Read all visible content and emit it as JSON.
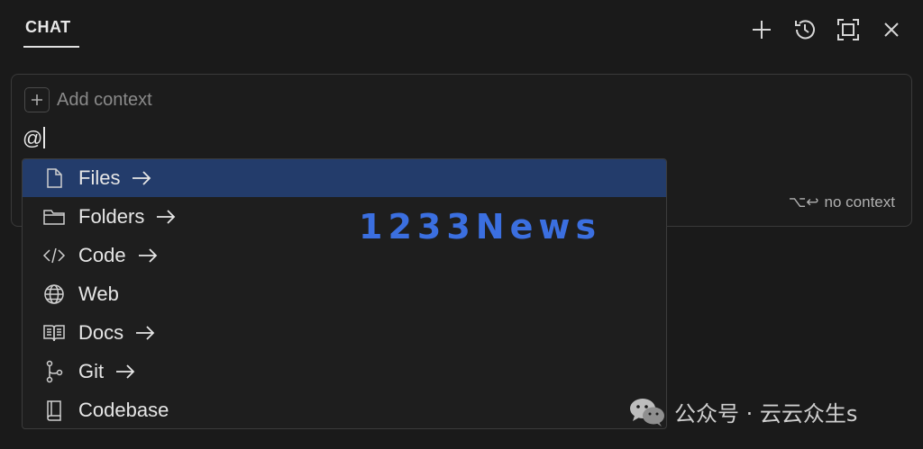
{
  "header": {
    "tab_label": "CHAT",
    "actions": [
      {
        "name": "new-chat",
        "icon": "plus-icon"
      },
      {
        "name": "history",
        "icon": "history-icon"
      },
      {
        "name": "maximize",
        "icon": "maximize-icon"
      },
      {
        "name": "close",
        "icon": "close-icon"
      }
    ]
  },
  "chat_input": {
    "add_context_label": "Add context",
    "typed_value": "@",
    "hint_keys": "⌥↩",
    "hint_label": "no context"
  },
  "mention_menu": {
    "selected_index": 0,
    "items": [
      {
        "label": "Files",
        "icon": "file-icon",
        "has_submenu": true
      },
      {
        "label": "Folders",
        "icon": "folder-icon",
        "has_submenu": true
      },
      {
        "label": "Code",
        "icon": "code-icon",
        "has_submenu": true
      },
      {
        "label": "Web",
        "icon": "globe-icon",
        "has_submenu": false
      },
      {
        "label": "Docs",
        "icon": "book-icon",
        "has_submenu": true
      },
      {
        "label": "Git",
        "icon": "git-branch-icon",
        "has_submenu": true
      },
      {
        "label": "Codebase",
        "icon": "codebase-icon",
        "has_submenu": false
      }
    ]
  },
  "overlays": {
    "watermark_text": "1233News",
    "wechat_text": "公众号 · 云云众生s"
  },
  "colors": {
    "background": "#1a1a1a",
    "selected_item": "#233c6b",
    "watermark": "#3b6fe0"
  }
}
